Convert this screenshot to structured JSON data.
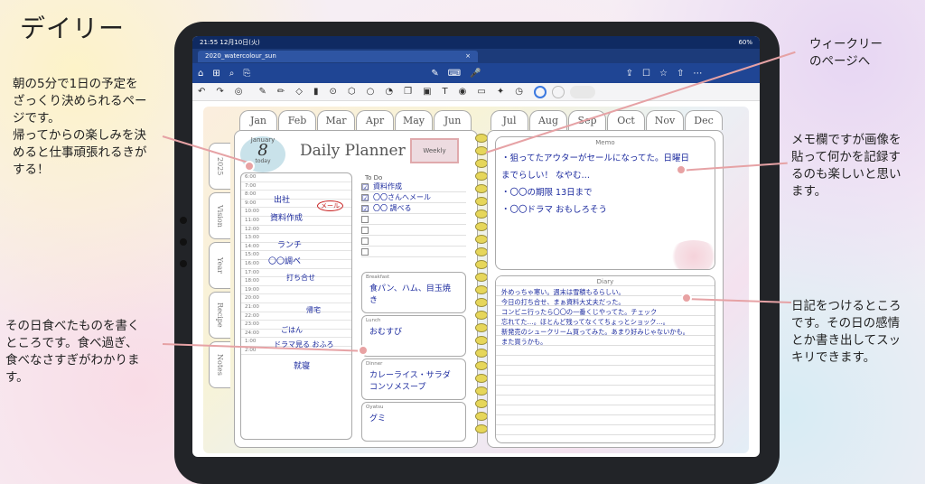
{
  "page_title": "デイリー",
  "notes": {
    "left_top": [
      "朝の5分で1日の予定を",
      "ざっくり決められるペー",
      "ジです。",
      "帰ってからの楽しみを決",
      "めると仕事頑張れるきが",
      "する！"
    ],
    "left_bottom": [
      "その日食べたものを書く",
      "ところです。食べ過ぎ、",
      "食べなさすぎがわかりま",
      "す。"
    ],
    "right_top": [
      "ウィークリー",
      "のページへ"
    ],
    "right_mid": [
      "メモ欄ですが画像を",
      "貼って何かを記録す",
      "るのも楽しいと思い",
      "ます。"
    ],
    "right_bottom": [
      "日記をつけるところ",
      "です。その日の感情",
      "とか書き出してスッ",
      "キリできます。"
    ]
  },
  "status_bar": {
    "time": "21:55",
    "date": "12月10日(火)",
    "battery": "60%"
  },
  "tab": {
    "label": "2020_watercolour_sun",
    "close": "×"
  },
  "icons": {
    "toolbar1": [
      "home-icon",
      "grid-icon",
      "search-icon",
      "share-icon",
      "pen-icon",
      "keyboard-icon",
      "mic-icon",
      "export-icon",
      "bookmark-icon",
      "bookmarks-icon",
      "upload-icon",
      "more-icon"
    ],
    "toolbar2": [
      "undo-icon",
      "redo-icon",
      "lasso-icon",
      "pen-icon",
      "pencil-icon",
      "eraser-icon",
      "highlighter-icon",
      "zoom-icon",
      "shapes-icon",
      "lasso2-icon",
      "sticker-icon",
      "copy-icon",
      "image-icon",
      "text-icon",
      "camera-icon",
      "ruler-icon",
      "laser-icon",
      "timer-icon"
    ]
  },
  "glyphs": {
    "toolbar1": [
      "⌂",
      "⊞",
      "⌕",
      "⎘",
      "✎",
      "⌨",
      "🎤",
      "⇪",
      "☐",
      "☆",
      "⇧",
      "⋯"
    ],
    "toolbar2": [
      "↶",
      "↷",
      "◎",
      "✎",
      "✏",
      "◇",
      "▮",
      "⊙",
      "⬡",
      "○",
      "◔",
      "❐",
      "▣",
      "T",
      "◉",
      "▭",
      "✦",
      "◷"
    ]
  },
  "months": [
    "Jan",
    "Feb",
    "Mar",
    "Apr",
    "May",
    "Jun",
    "Jul",
    "Aug",
    "Sep",
    "Oct",
    "Nov",
    "Dec"
  ],
  "side_tabs": [
    "2025",
    "Vision",
    "Year",
    "Recipe",
    "Notes"
  ],
  "planner": {
    "month_label": "January",
    "day": "8",
    "today": "today",
    "title": "Daily Planner",
    "weekly_button": "Weekly",
    "times": [
      "6:00",
      "7:00",
      "8:00",
      "9:00",
      "10:00",
      "11:00",
      "12:00",
      "13:00",
      "14:00",
      "15:00",
      "16:00",
      "17:00",
      "18:00",
      "19:00",
      "20:00",
      "21:00",
      "22:00",
      "23:00",
      "24:00",
      "1:00",
      "2:00"
    ],
    "schedule": [
      "出社",
      "メール",
      "資料作成",
      "ランチ",
      "〇〇調べ",
      "打ち合せ",
      "帰宅",
      "ごはん",
      "ドラマ見る おふろ",
      "就寝"
    ],
    "todo_title": "To Do",
    "todos": [
      {
        "checked": "☑",
        "text": "資料作成"
      },
      {
        "checked": "☑",
        "text": "〇〇さんへメール"
      },
      {
        "checked": "☑",
        "text": "〇〇 調べる"
      },
      {
        "checked": "",
        "text": ""
      },
      {
        "checked": "",
        "text": ""
      },
      {
        "checked": "",
        "text": ""
      },
      {
        "checked": "",
        "text": ""
      }
    ],
    "meals": [
      {
        "label": "Breakfast",
        "text": "食パン、ハム、目玉焼き"
      },
      {
        "label": "Lunch",
        "text": "おむすび"
      },
      {
        "label": "Dinner",
        "text": "カレーライス・サラダ コンソメスープ"
      },
      {
        "label": "Oyatsu",
        "text": "グミ"
      }
    ],
    "memo_label": "Memo",
    "memo_lines": [
      "・狙ってたアウターがセールになってた。日曜日",
      "までらしい！ なやむ…",
      "・〇〇の期限 13日まで",
      "・〇〇ドラマ おもしろそう"
    ],
    "diary_label": "Diary",
    "diary_lines": [
      "外めっちゃ寒い。週末は雪積もるらしい。",
      "今日の打ち合せ、まぁ資料大丈夫だった。",
      "コンビニ行ったら〇〇の一番くじやってた。チェック",
      "忘れてた…。ほとんど残ってなくてちょっとショック…。",
      "新発売のシュークリーム買ってみた。あまり好みじゃないかも。",
      "また買うかも。"
    ]
  }
}
